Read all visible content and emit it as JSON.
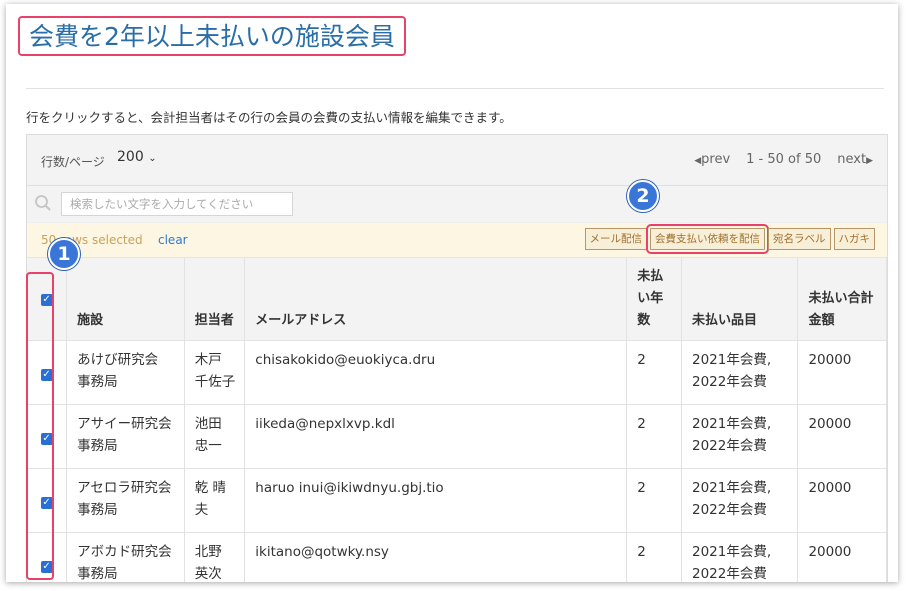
{
  "page": {
    "title": "会費を2年以上未払いの施設会員",
    "description": "行をクリックすると、会計担当者はその行の会員の会費の支払い情報を編集できます。"
  },
  "toolbar": {
    "rows_label": "行数/ページ",
    "rows_value": "200",
    "prev": "prev",
    "range": "1 - 50 of 50",
    "next": "next"
  },
  "search": {
    "placeholder": "検索したい文字を入力してください"
  },
  "selection": {
    "count_text": "50 rows selected",
    "clear": "clear",
    "actions": [
      "メール配信",
      "会費支払い依頼を配信",
      "宛名ラベル",
      "ハガキ"
    ]
  },
  "annotations": {
    "badge1": "1",
    "badge2": "2"
  },
  "table": {
    "headers": [
      "施設",
      "担当者",
      "メールアドレス",
      "未払い年数",
      "未払い品目",
      "未払い合計金額"
    ],
    "rows": [
      {
        "facility": "あけび研究会 事務局",
        "person": "木戸 千佐子",
        "email": "chisakokido@euokiyca.dru",
        "years": "2",
        "items": "2021年会費, 2022年会費",
        "total": "20000"
      },
      {
        "facility": "アサイー研究会 事務局",
        "person": "池田 忠一",
        "email": "iikeda@nepxlxvp.kdl",
        "years": "2",
        "items": "2021年会費, 2022年会費",
        "total": "20000"
      },
      {
        "facility": "アセロラ研究会 事務局",
        "person": "乾 晴夫",
        "email": "haruo inui@ikiwdnyu.gbj.tio",
        "years": "2",
        "items": "2021年会費, 2022年会費",
        "total": "20000"
      },
      {
        "facility": "アボカド研究会 事務局",
        "person": "北野 英次",
        "email": "ikitano@qotwky.nsy",
        "years": "2",
        "items": "2021年会費, 2022年会費",
        "total": "20000"
      }
    ]
  },
  "colors": {
    "accent": "#2a6ea8",
    "highlight": "#e8426a",
    "badge": "#3a76d8",
    "checkbox": "#2a6fd6"
  }
}
